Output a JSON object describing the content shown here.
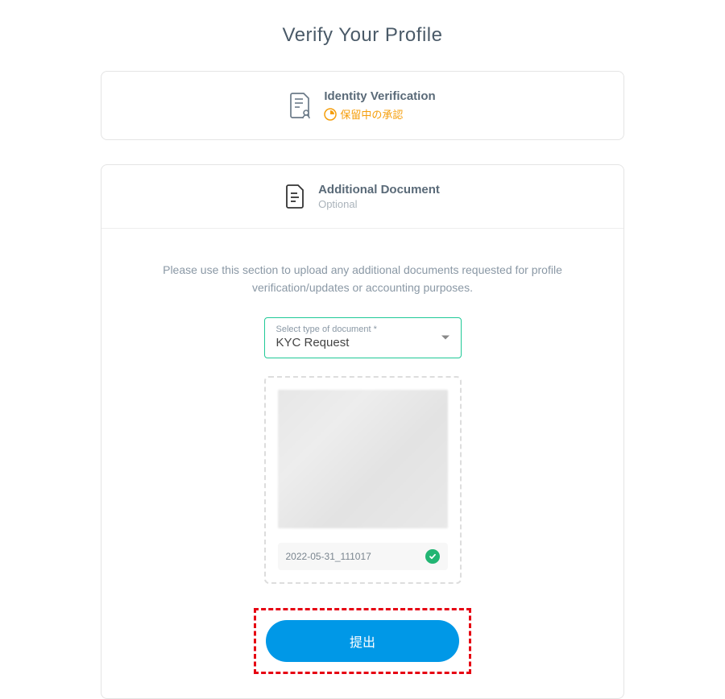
{
  "page_title": "Verify Your Profile",
  "identity_card": {
    "title": "Identity Verification",
    "status": "保留中の承認"
  },
  "doc_card": {
    "title": "Additional Document",
    "subtitle": "Optional",
    "instruction": "Please use this section to upload any additional documents requested for profile verification/updates or accounting purposes.",
    "select_label": "Select type of document *",
    "select_value": "KYC Request",
    "file_name": "2022-05-31_111017",
    "submit_label": "提出"
  }
}
